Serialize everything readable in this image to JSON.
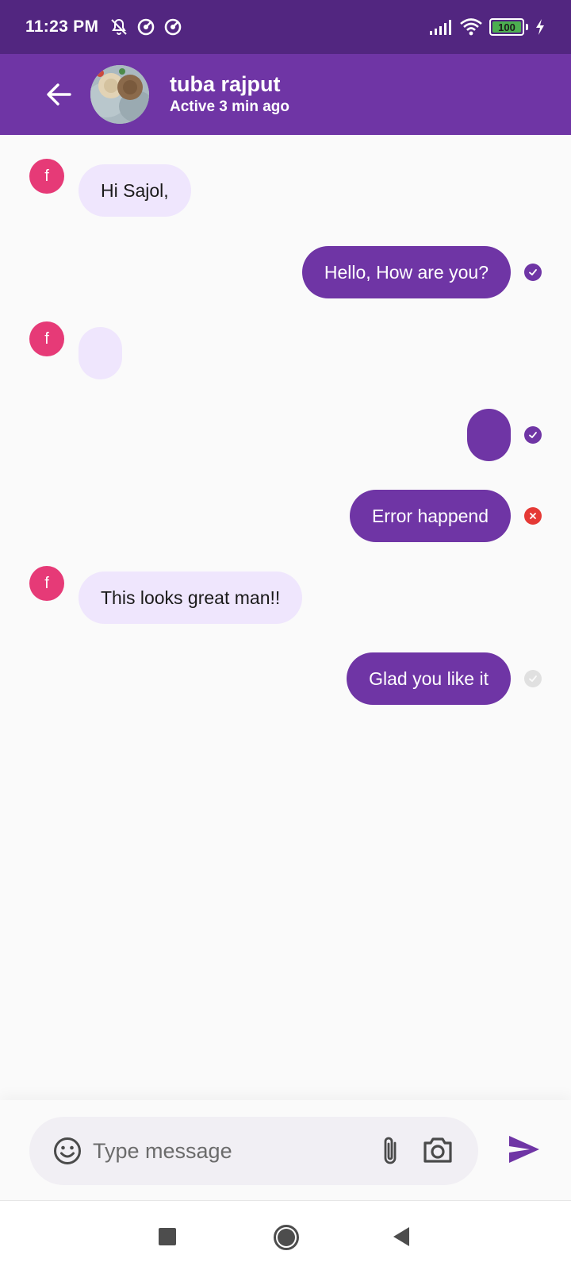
{
  "status_bar": {
    "time": "11:23 PM",
    "battery": "100"
  },
  "header": {
    "name": "tuba rajput",
    "status": "Active 3 min ago"
  },
  "messages": [
    {
      "direction": "in",
      "text": "Hi Sajol,",
      "avatar_letter": "f"
    },
    {
      "direction": "out",
      "text": "Hello, How are you?",
      "state": "sent"
    },
    {
      "direction": "in",
      "text": "",
      "avatar_letter": "f"
    },
    {
      "direction": "out",
      "text": "",
      "state": "sent"
    },
    {
      "direction": "out",
      "text": "Error happend",
      "state": "error"
    },
    {
      "direction": "in",
      "text": "This looks great man!!",
      "avatar_letter": "f"
    },
    {
      "direction": "out",
      "text": "Glad you like it",
      "state": "pending"
    }
  ],
  "composer": {
    "placeholder": "Type message"
  },
  "colors": {
    "primary": "#6f35a5",
    "status_bar": "#522680",
    "incoming_bubble": "#efe6fd",
    "avatar": "#e63a77",
    "error": "#e53935"
  },
  "icons": [
    "back-arrow-icon",
    "emoji-icon",
    "attach-icon",
    "camera-icon",
    "send-icon",
    "check-icon",
    "close-icon"
  ]
}
